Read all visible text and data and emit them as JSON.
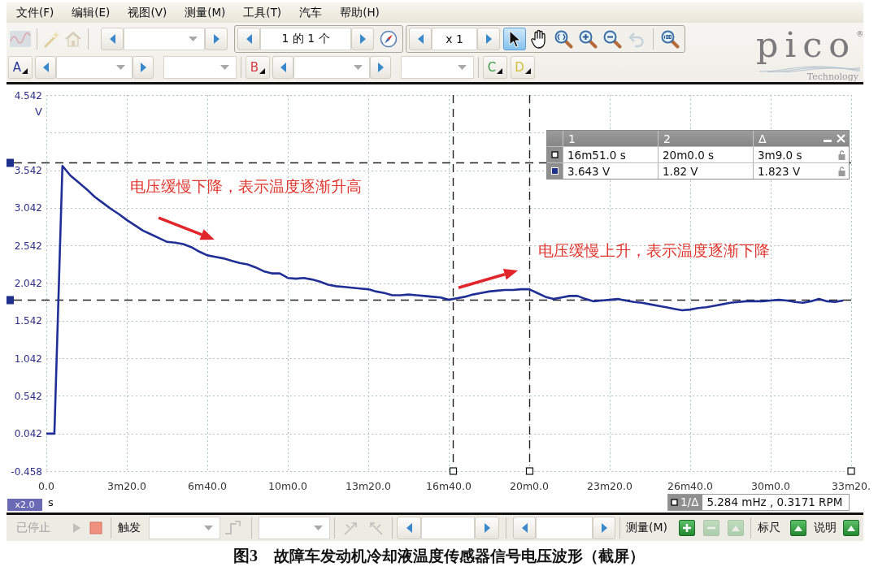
{
  "menu": [
    "文件(F)",
    "编辑(E)",
    "视图(V)",
    "测量(M)",
    "工具(T)",
    "汽车",
    "帮助(H)"
  ],
  "toolbar": {
    "app_tools": [
      {
        "kind": "waveform",
        "disabled": true
      },
      {
        "kind": "wand",
        "disabled": true
      },
      {
        "kind": "home",
        "disabled": true
      }
    ],
    "page_nav": {
      "value": "1 的 1 个"
    },
    "zoom_nav": {
      "value": "x 1"
    },
    "view_tools": [
      {
        "kind": "pointer",
        "selected": true,
        "disabled": false
      },
      {
        "kind": "hand",
        "selected": false,
        "disabled": false
      },
      {
        "kind": "zoom-fit",
        "selected": false,
        "disabled": false
      },
      {
        "kind": "zoom-in",
        "selected": false,
        "disabled": false
      },
      {
        "kind": "zoom-out",
        "selected": false,
        "disabled": false
      },
      {
        "kind": "undo",
        "selected": false,
        "disabled": true
      },
      {
        "kind": "zoom-100",
        "selected": false,
        "disabled": false
      }
    ]
  },
  "channels": [
    {
      "label": "A",
      "color": "#2b3a9c",
      "kind": "with-range"
    },
    {
      "label": "B",
      "color": "#d43a44",
      "kind": "with-range"
    },
    {
      "label": "C",
      "color": "#3a9a44",
      "kind": "button"
    },
    {
      "label": "D",
      "color": "#d2c03c",
      "kind": "button"
    }
  ],
  "logo": {
    "name": "pico$^{®}$",
    "tagline": "Technology"
  },
  "chart": {
    "chart_data": {
      "type": "line",
      "xlabel": "s",
      "ylabel": "V",
      "grid": true,
      "categories": [
        "0.0",
        null,
        null,
        null,
        null,
        null,
        null,
        null,
        null,
        null,
        "3m20.0",
        null,
        null,
        null,
        null,
        null,
        null,
        null,
        null,
        null,
        "6m40.0",
        null,
        null,
        null,
        null,
        null,
        null,
        null,
        null,
        null,
        "10m0.0",
        null,
        null,
        null,
        null,
        null,
        null,
        null,
        null,
        null,
        "13m20.0",
        null,
        null,
        null,
        null,
        null,
        null,
        null,
        null,
        null,
        "16m40.0",
        null,
        null,
        null,
        null,
        null,
        null,
        null,
        null,
        null,
        "20m0.0",
        null,
        null,
        null,
        null,
        null,
        null,
        null,
        null,
        null,
        "23m20.0",
        null,
        null,
        null,
        null,
        null,
        null,
        null,
        null,
        null,
        "26m40.0",
        null,
        null,
        null,
        null,
        null,
        null,
        null,
        null,
        null,
        "30m0.0",
        null,
        null,
        null,
        null,
        null,
        null,
        null,
        null,
        null,
        "33m20."
      ],
      "series": [
        {
          "color": "#1f2f96",
          "values": [
            0.04,
            0.04,
            3.6,
            3.47,
            3.38,
            3.29,
            3.19,
            3.11,
            3.03,
            2.96,
            2.88,
            2.81,
            2.74,
            2.69,
            2.64,
            2.59,
            2.58,
            2.56,
            2.52,
            2.46,
            2.41,
            2.39,
            2.37,
            2.34,
            2.31,
            2.29,
            2.25,
            2.2,
            2.17,
            2.17,
            2.11,
            2.1,
            2.11,
            2.09,
            2.06,
            2.02,
            2.0,
            1.99,
            1.98,
            1.97,
            1.96,
            1.93,
            1.91,
            1.88,
            1.88,
            1.89,
            1.88,
            1.87,
            1.86,
            1.85,
            1.82,
            1.84,
            1.86,
            1.89,
            1.91,
            1.93,
            1.94,
            1.95,
            1.95,
            1.96,
            1.96,
            1.91,
            1.86,
            1.83,
            1.85,
            1.87,
            1.87,
            1.83,
            1.8,
            1.81,
            1.82,
            1.83,
            1.81,
            1.79,
            1.78,
            1.76,
            1.74,
            1.72,
            1.7,
            1.68,
            1.69,
            1.71,
            1.72,
            1.74,
            1.76,
            1.78,
            1.79,
            1.8,
            1.8,
            1.8,
            1.81,
            1.82,
            1.81,
            1.79,
            1.78,
            1.8,
            1.83,
            1.8,
            1.79,
            1.81,
            null
          ]
        }
      ],
      "ylim": [
        -0.458,
        4.542
      ],
      "yticks": [
        4.542,
        3.542,
        3.042,
        2.542,
        2.042,
        1.542,
        1.042,
        0.542,
        0.042,
        -0.458
      ],
      "ref_lines": [
        {
          "axis": "y",
          "value": 3.643
        },
        {
          "axis": "y",
          "value": 1.82
        }
      ],
      "annotations": [
        "电压缓慢下降，表示温度逐渐升高",
        "电压缓慢上升，表示温度逐渐下降"
      ]
    },
    "zoom_factor": "x2.0",
    "ruler_table": {
      "columns": [
        "1",
        "2",
        "Δ"
      ],
      "rows": [
        {
          "kind": "time",
          "cells": [
            "16m51.0 s",
            "20m0.0 s",
            "3m9.0 s"
          ]
        },
        {
          "kind": "voltage",
          "cells": [
            "3.643 V",
            "1.82 V",
            "1.823 V"
          ]
        }
      ]
    },
    "frequency": {
      "label": "1/Δ",
      "value": "5.284 mHz , 0.3171 RPM"
    }
  },
  "status_bar": {
    "state": {
      "label": "已停止",
      "disabled": true
    },
    "run_buttons": [
      {
        "kind": "play",
        "disabled": true
      },
      {
        "kind": "stop",
        "disabled": false
      }
    ],
    "trigger": {
      "label": "触发",
      "tools": [
        {
          "kind": "edge",
          "disabled": true
        },
        {
          "kind": "cursor-left",
          "disabled": true
        },
        {
          "kind": "cursor-right",
          "disabled": true
        }
      ]
    },
    "measurements": {
      "label": "测量(M)",
      "buttons": [
        {
          "kind": "add",
          "disabled": false
        },
        {
          "kind": "remove",
          "disabled": true
        },
        {
          "kind": "edit",
          "disabled": true
        }
      ]
    },
    "rulers": {
      "label": "标尺"
    },
    "notes": {
      "label": "说明"
    }
  },
  "caption": {
    "label": "图3",
    "text": "故障车发动机冷却液温度传感器信号电压波形（截屏）"
  }
}
